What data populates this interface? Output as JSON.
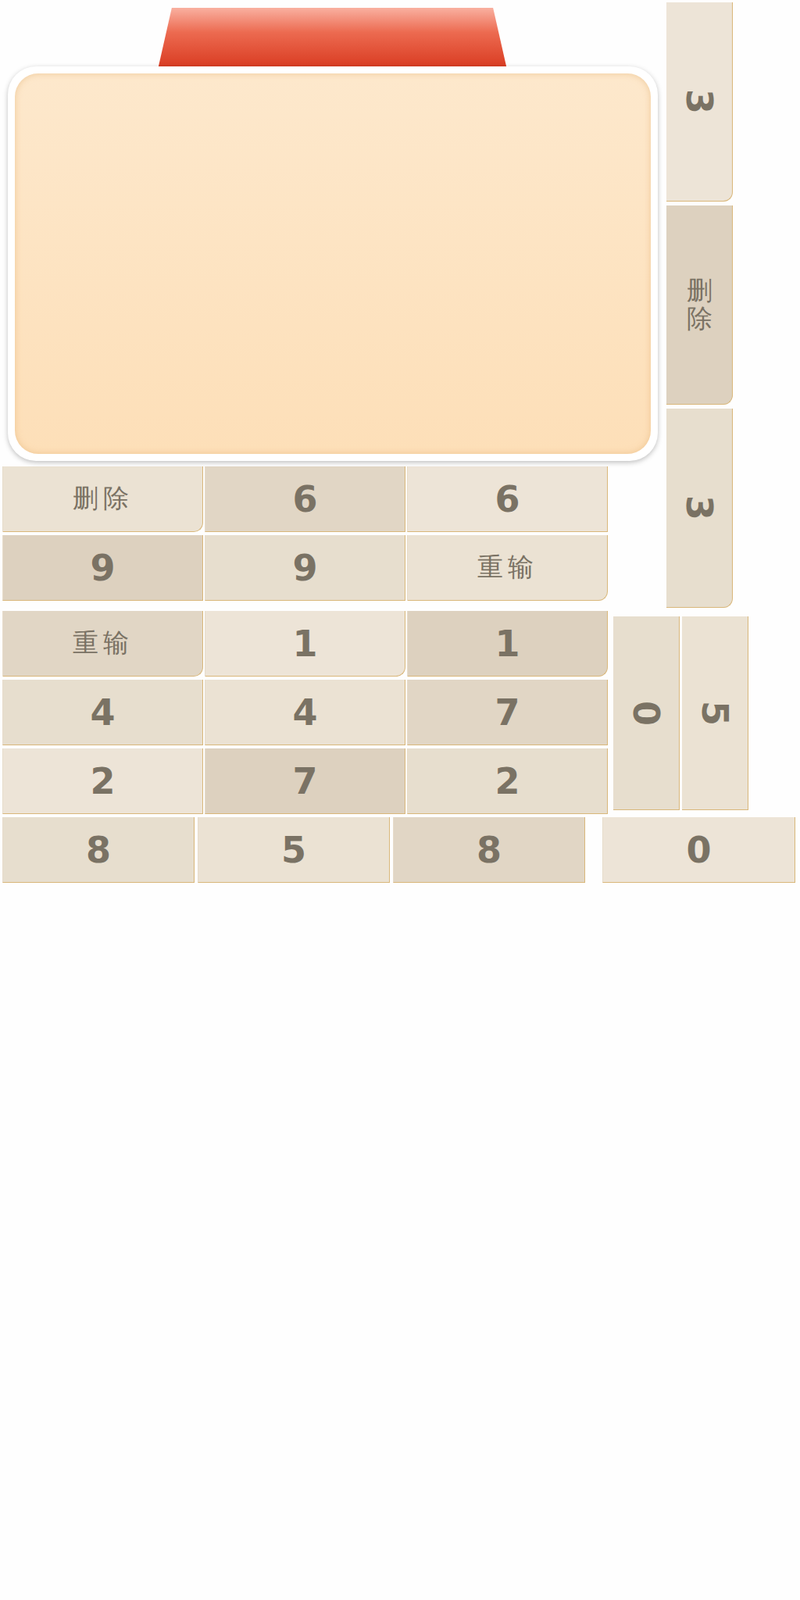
{
  "side_keys": [
    "3",
    "删除",
    "3"
  ],
  "rows": [
    [
      "删除",
      "6",
      "6"
    ],
    [
      "9",
      "9",
      "重输"
    ],
    [
      "重输",
      "1",
      "1"
    ],
    [
      "4",
      "4",
      "7"
    ],
    [
      "2",
      "7",
      "2"
    ]
  ],
  "side_keys_2": [
    "0",
    "5"
  ],
  "bottom_row": [
    "8",
    "5",
    "8",
    "0"
  ]
}
